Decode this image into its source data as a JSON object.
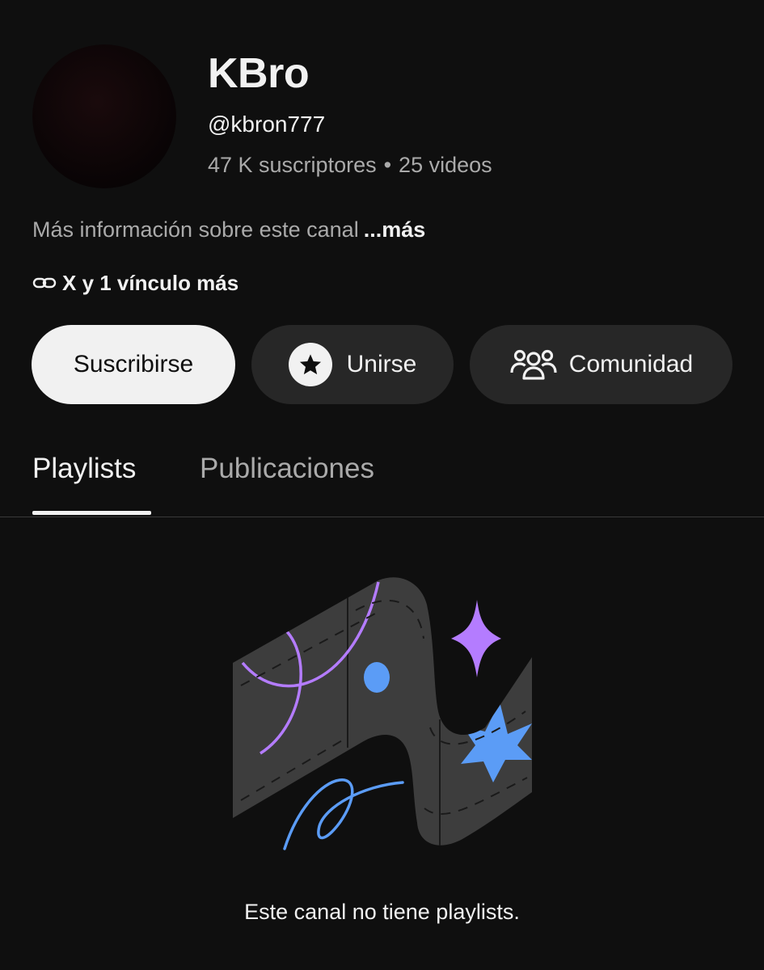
{
  "channel": {
    "name": "KBro",
    "handle": "@kbron777",
    "subscribers": "47 K suscriptores",
    "separator": "•",
    "videos": "25 videos",
    "about_text": "Más información sobre este canal",
    "about_more": "...más",
    "links_text": "X y 1 vínculo más"
  },
  "actions": {
    "subscribe_label": "Suscribirse",
    "join_label": "Unirse",
    "community_label": "Comunidad"
  },
  "tabs": [
    {
      "label": "Playlists",
      "selected": true
    },
    {
      "label": "Publicaciones",
      "selected": false
    }
  ],
  "empty_state": {
    "message": "Este canal no tiene playlists."
  },
  "icons": {
    "link": "link-icon",
    "join": "star-icon",
    "community": "people-icon"
  },
  "colors": {
    "background": "#0f0f0f",
    "button_dark": "#272727",
    "button_light": "#f1f1f1",
    "accent_purple": "#a970ff",
    "accent_blue": "#5b9cf6"
  }
}
